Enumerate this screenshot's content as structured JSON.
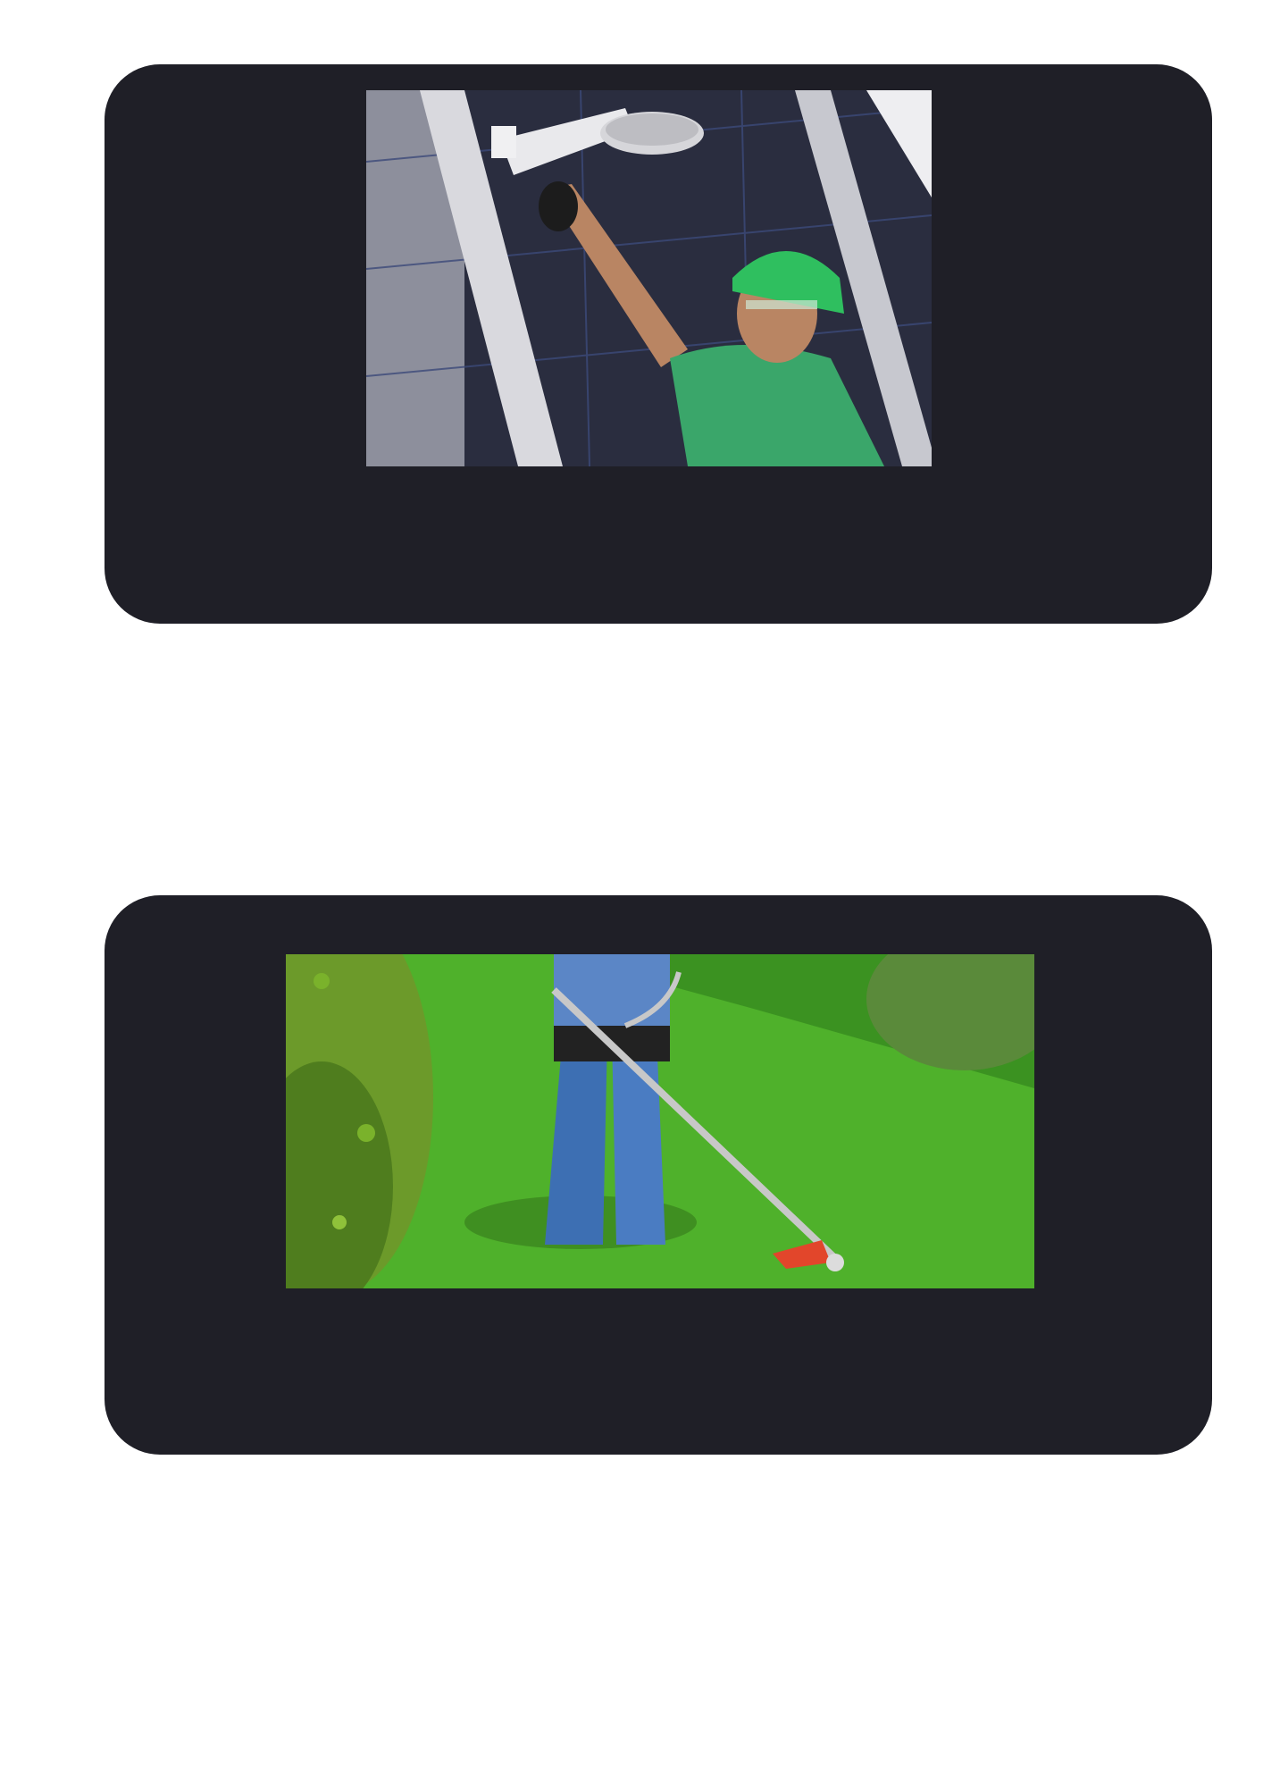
{
  "cards": [
    {
      "image": {
        "subject": "worker-installing-shower",
        "colors": {
          "tile": "#2a2d3f",
          "frame": "#d9d9de",
          "shirt": "#3aa66a",
          "helmet": "#2fbf5f",
          "skin": "#b98563",
          "shower": "#e9e9ec"
        }
      }
    },
    {
      "image": {
        "subject": "gardener-trimming-lawn",
        "colors": {
          "grass": "#4fb12b",
          "grass_dark": "#2f7d1a",
          "shrub": "#6c9a2a",
          "jeans": "#3d6fb3",
          "trimmer": "#c8c8c8",
          "trimmer_head": "#e2462b"
        }
      }
    }
  ],
  "colors": {
    "page_background": "#ffffff",
    "card_background": "#1f1f27"
  }
}
